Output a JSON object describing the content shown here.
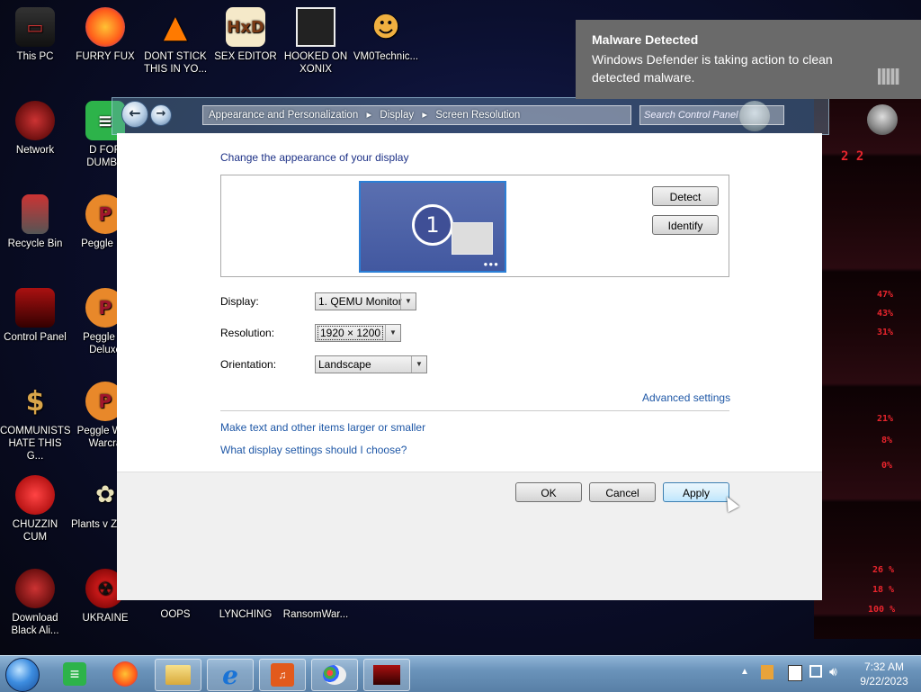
{
  "desktop": {
    "icons": [
      {
        "label": "This PC"
      },
      {
        "label": "FURRY FUX"
      },
      {
        "label": "DONT STICK THIS IN YO..."
      },
      {
        "label": "SEX EDITOR"
      },
      {
        "label": "HOOKED ON XONIX"
      },
      {
        "label": "VM0Technic..."
      },
      {
        "label": "Network"
      },
      {
        "label": "D FOR DUMBA"
      },
      {
        "label": "Recycle Bin"
      },
      {
        "label": "Peggle De"
      },
      {
        "label": "Control Panel"
      },
      {
        "label": "Peggle Ni Deluxe"
      },
      {
        "label": "COMMUNISTS HATE THIS G..."
      },
      {
        "label": "Peggle W of Warcra"
      },
      {
        "label": "CHUZZIN CUM"
      },
      {
        "label": "Plants v Zombi"
      },
      {
        "label": "Download Black Ali..."
      },
      {
        "label": "UKRAINE"
      },
      {
        "label": "OOPS"
      },
      {
        "label": "LYNCHING"
      },
      {
        "label": "RansomWar..."
      }
    ],
    "wallpaper_numbers": [
      "2 2",
      "47%",
      "43%",
      "31%",
      "21%",
      "8%",
      "0%",
      "26 %",
      "18 %",
      "100 %"
    ]
  },
  "window": {
    "breadcrumb": [
      "Appearance and Personalization",
      "Display",
      "Screen Resolution"
    ],
    "search_placeholder": "Search Control Panel",
    "heading": "Change the appearance of your display",
    "monitor_number": "1",
    "detect_label": "Detect",
    "identify_label": "Identify",
    "display_label": "Display:",
    "display_value": "1. QEMU Monitor",
    "resolution_label": "Resolution:",
    "resolution_value": "1920 × 1200",
    "orientation_label": "Orientation:",
    "orientation_value": "Landscape",
    "advanced_link": "Advanced settings",
    "link_text_size": "Make text and other items larger or smaller",
    "link_display_help": "What display settings should I choose?",
    "ok_label": "OK",
    "cancel_label": "Cancel",
    "apply_label": "Apply"
  },
  "toast": {
    "title": "Malware Detected",
    "message": "Windows Defender is taking action to clean detected malware."
  },
  "taskbar": {
    "time": "7:32 AM",
    "date": "9/22/2023"
  },
  "colors": {
    "accent": "#1e57a6",
    "heading": "#1e3287",
    "toast_bg": "#6a6a6a",
    "taskbar": "#6a93ba"
  }
}
